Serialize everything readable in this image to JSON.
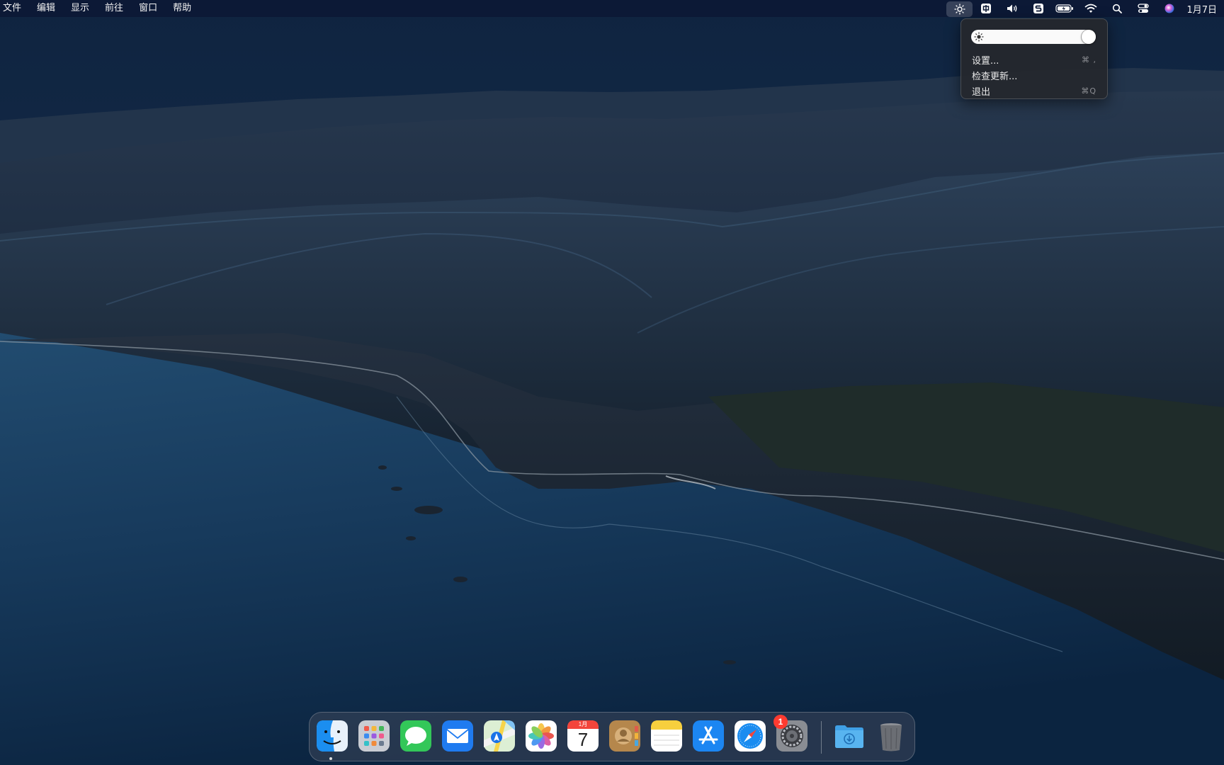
{
  "menu_bar": {
    "menus": [
      "文件",
      "编辑",
      "显示",
      "前往",
      "窗口",
      "帮助"
    ],
    "status_icons": [
      "brightness-icon",
      "input-method-icon",
      "volume-icon",
      "app-s-icon",
      "battery-charging-icon",
      "wifi-icon",
      "spotlight-icon",
      "control-center-icon",
      "siri-icon"
    ],
    "clock": "1月7日"
  },
  "dropdown": {
    "items": [
      {
        "label": "设置...",
        "shortcut": "⌘ ,"
      },
      {
        "label": "检查更新...",
        "shortcut": ""
      },
      {
        "label": "退出",
        "shortcut": "⌘Q"
      }
    ],
    "brightness_level": 1.0
  },
  "dock": {
    "apps": [
      "Finder",
      "Launchpad",
      "Messages",
      "Mail",
      "Maps",
      "Photos",
      "Calendar",
      "Contacts",
      "Notes",
      "App Store",
      "Safari",
      "System Settings",
      "Downloads",
      "Trash"
    ],
    "calendar_month": "1月",
    "calendar_day": "7",
    "settings_badge": "1"
  },
  "colors": {
    "menubar": "#0c1834",
    "accent_blue": "#1a73e8",
    "badge_red": "#ff3b30"
  }
}
